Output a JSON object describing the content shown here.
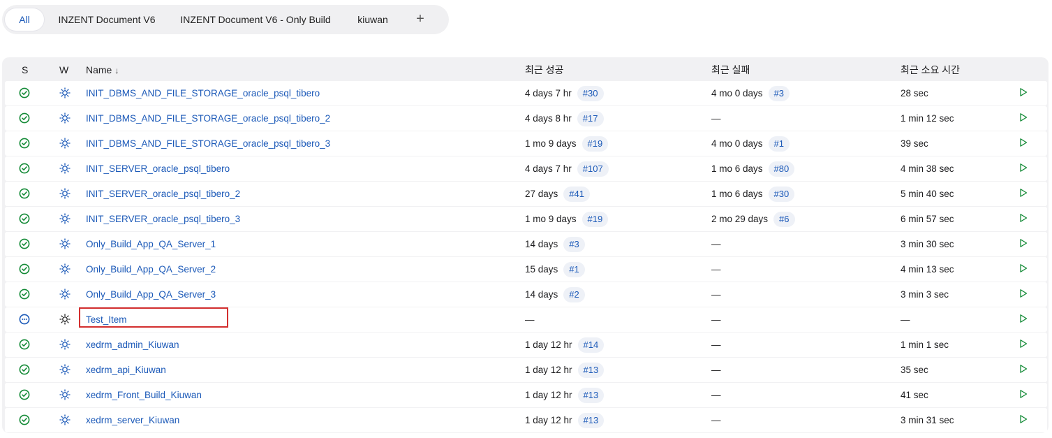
{
  "tabs": [
    {
      "label": "All",
      "active": true
    },
    {
      "label": "INZENT Document V6",
      "active": false
    },
    {
      "label": "INZENT Document V6 - Only Build",
      "active": false
    },
    {
      "label": "kiuwan",
      "active": false
    }
  ],
  "add_tab_icon": "plus-icon",
  "add_tab_label": "+",
  "table": {
    "headers": {
      "s": "S",
      "w": "W",
      "name": "Name",
      "name_sort": "↓",
      "last_success": "최근 성공",
      "last_failure": "최근 실패",
      "last_duration": "최근 소요 시간"
    },
    "rows": [
      {
        "status": "success",
        "name": "INIT_DBMS_AND_FILE_STORAGE_oracle_psql_tibero",
        "success_time": "4 days 7 hr",
        "success_build": "#30",
        "failure_time": "4 mo 0 days",
        "failure_build": "#3",
        "duration": "28 sec"
      },
      {
        "status": "success",
        "name": "INIT_DBMS_AND_FILE_STORAGE_oracle_psql_tibero_2",
        "success_time": "4 days 8 hr",
        "success_build": "#17",
        "failure_time": "—",
        "failure_build": "",
        "duration": "1 min 12 sec"
      },
      {
        "status": "success",
        "name": "INIT_DBMS_AND_FILE_STORAGE_oracle_psql_tibero_3",
        "success_time": "1 mo 9 days",
        "success_build": "#19",
        "failure_time": "4 mo 0 days",
        "failure_build": "#1",
        "duration": "39 sec"
      },
      {
        "status": "success",
        "name": "INIT_SERVER_oracle_psql_tibero",
        "success_time": "4 days 7 hr",
        "success_build": "#107",
        "failure_time": "1 mo 6 days",
        "failure_build": "#80",
        "duration": "4 min 38 sec"
      },
      {
        "status": "success",
        "name": "INIT_SERVER_oracle_psql_tibero_2",
        "success_time": "27 days",
        "success_build": "#41",
        "failure_time": "1 mo 6 days",
        "failure_build": "#30",
        "duration": "5 min 40 sec"
      },
      {
        "status": "success",
        "name": "INIT_SERVER_oracle_psql_tibero_3",
        "success_time": "1 mo 9 days",
        "success_build": "#19",
        "failure_time": "2 mo 29 days",
        "failure_build": "#6",
        "duration": "6 min 57 sec"
      },
      {
        "status": "success",
        "name": "Only_Build_App_QA_Server_1",
        "success_time": "14 days",
        "success_build": "#3",
        "failure_time": "—",
        "failure_build": "",
        "duration": "3 min 30 sec"
      },
      {
        "status": "success",
        "name": "Only_Build_App_QA_Server_2",
        "success_time": "15 days",
        "success_build": "#1",
        "failure_time": "—",
        "failure_build": "",
        "duration": "4 min 13 sec"
      },
      {
        "status": "success",
        "name": "Only_Build_App_QA_Server_3",
        "success_time": "14 days",
        "success_build": "#2",
        "failure_time": "—",
        "failure_build": "",
        "duration": "3 min 3 sec"
      },
      {
        "status": "not-built",
        "name": "Test_Item",
        "success_time": "—",
        "success_build": "",
        "failure_time": "—",
        "failure_build": "",
        "duration": "—"
      },
      {
        "status": "success",
        "name": "xedrm_admin_Kiuwan",
        "success_time": "1 day 12 hr",
        "success_build": "#14",
        "failure_time": "—",
        "failure_build": "",
        "duration": "1 min 1 sec"
      },
      {
        "status": "success",
        "name": "xedrm_api_Kiuwan",
        "success_time": "1 day 12 hr",
        "success_build": "#13",
        "failure_time": "—",
        "failure_build": "",
        "duration": "35 sec"
      },
      {
        "status": "success",
        "name": "xedrm_Front_Build_Kiuwan",
        "success_time": "1 day 12 hr",
        "success_build": "#13",
        "failure_time": "—",
        "failure_build": "",
        "duration": "41 sec"
      },
      {
        "status": "success",
        "name": "xedrm_server_Kiuwan",
        "success_time": "1 day 12 hr",
        "success_build": "#13",
        "failure_time": "—",
        "failure_build": "",
        "duration": "3 min 31 sec"
      }
    ]
  },
  "icons": {
    "success": "check-circle-icon",
    "not_built": "ellipsis-circle-icon",
    "weather_sunny": "sun-icon",
    "run": "play-icon"
  },
  "colors": {
    "accent": "#1b59b8",
    "success": "#138a36",
    "not_built": "#1b59b8",
    "highlight": "#d32f2f"
  }
}
